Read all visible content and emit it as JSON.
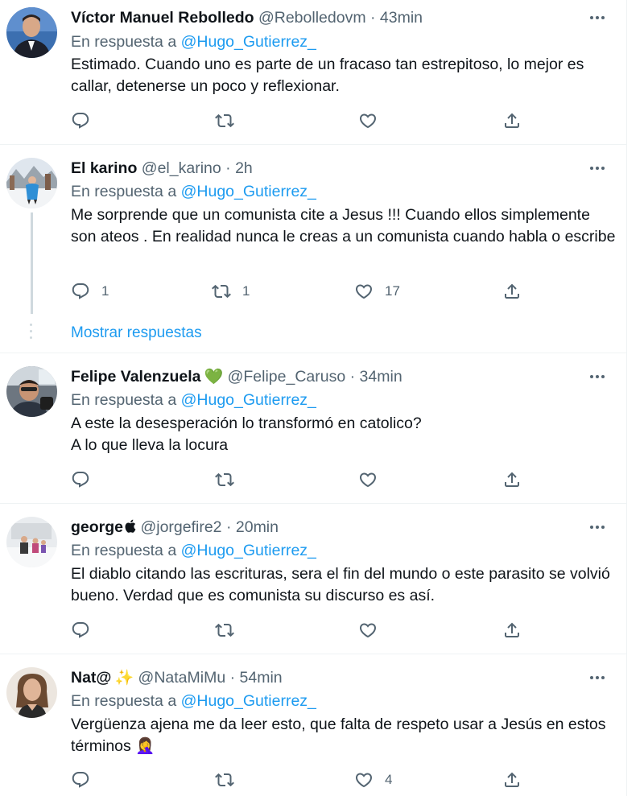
{
  "colors": {
    "link": "#1d9bf0",
    "secondary": "#536471",
    "text": "#0f1419",
    "divider": "#eff3f4"
  },
  "tweets": [
    {
      "name": "Víctor Manuel Rebolledo",
      "handle": "@Rebolledovm",
      "dot": "·",
      "time": "43min",
      "reply_prefix": "En respuesta a",
      "reply_to": "@Hugo_Gutierrez_",
      "lines": [
        "Estimado. Cuando uno es parte de un fracaso tan estrepitoso, lo mejor es callar, detenerse un poco y reflexionar."
      ],
      "counts": {
        "replies": "",
        "retweets": "",
        "likes": ""
      }
    },
    {
      "name": "El karino",
      "handle": "@el_karino",
      "dot": "·",
      "time": "2h",
      "reply_prefix": "En respuesta a",
      "reply_to": "@Hugo_Gutierrez_",
      "lines": [
        "Me sorprende que un comunista cite a Jesus !!! Cuando ellos simplemente son ateos . En realidad nunca le creas a un comunista cuando habla o escribe"
      ],
      "counts": {
        "replies": "1",
        "retweets": "1",
        "likes": "17"
      },
      "show_replies": "Mostrar respuestas"
    },
    {
      "name": "Felipe Valenzuela",
      "name_emoji": "💚",
      "handle": "@Felipe_Caruso",
      "dot": "·",
      "time": "34min",
      "reply_prefix": "En respuesta a",
      "reply_to": "@Hugo_Gutierrez_",
      "lines": [
        "A este la desesperación lo transformó en catolico?",
        "A lo que lleva la locura"
      ],
      "counts": {
        "replies": "",
        "retweets": "",
        "likes": ""
      }
    },
    {
      "name": "george",
      "name_emoji": "",
      "handle": "@jorgefire2",
      "dot": "·",
      "time": "20min",
      "reply_prefix": "En respuesta a",
      "reply_to": "@Hugo_Gutierrez_",
      "lines": [
        "El diablo citando las escrituras, sera el fin del mundo o este parasito se volvió bueno. Verdad que es comunista su discurso es así."
      ],
      "counts": {
        "replies": "",
        "retweets": "",
        "likes": ""
      }
    },
    {
      "name": "Nat@",
      "name_emoji": "✨",
      "handle": "@NataMiMu",
      "dot": "·",
      "time": "54min",
      "reply_prefix": "En respuesta a",
      "reply_to": "@Hugo_Gutierrez_",
      "lines": [
        "Vergüenza ajena me da leer esto, que falta de respeto usar a Jesús en estos términos 🤦‍♀️"
      ],
      "counts": {
        "replies": "",
        "retweets": "",
        "likes": "4"
      }
    }
  ]
}
